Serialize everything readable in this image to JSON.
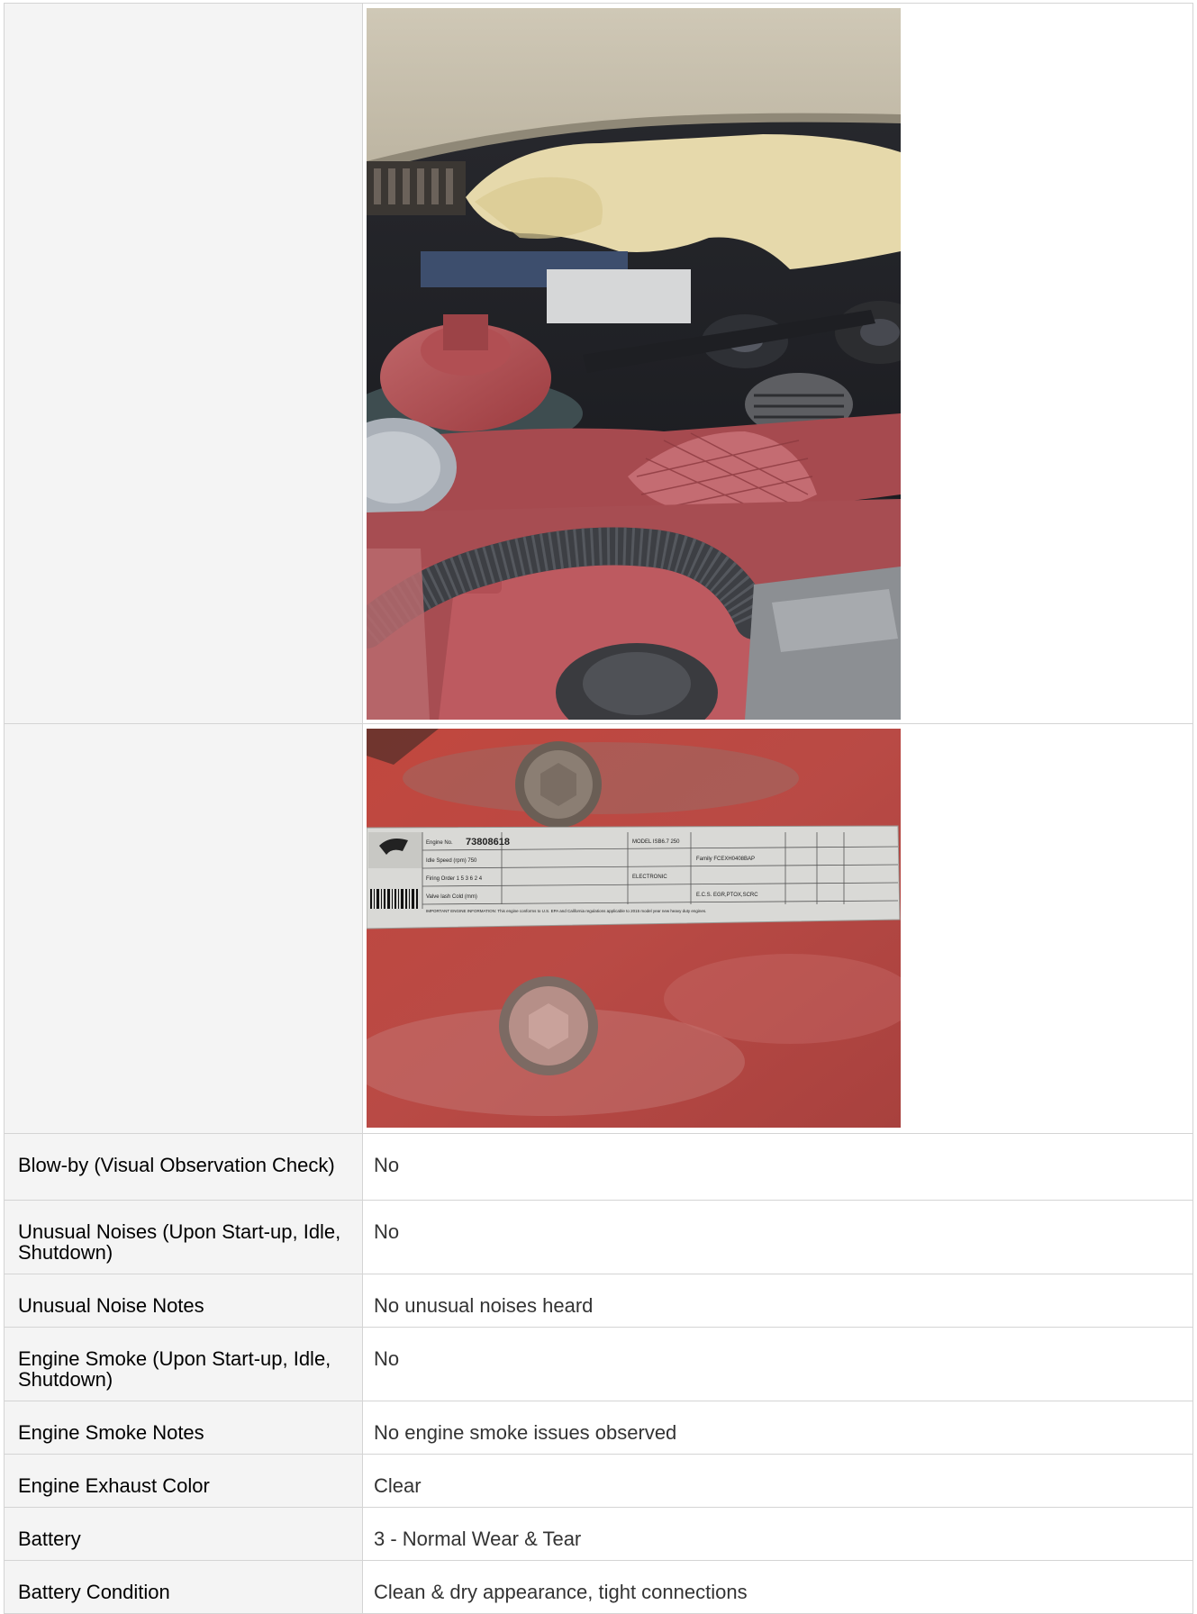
{
  "photos": [
    {
      "alt": "engine-bay-photo"
    },
    {
      "alt": "engine-data-plate-photo"
    }
  ],
  "plate_text": {
    "engine_no": "73808618",
    "model": "MODEL ISB6.7 250",
    "idle_speed": "Idle Speed (rpm) 750",
    "firing_order": "Firing Order 1 5 3 6 2 4",
    "valve_lash": "Valve lash Cold (mm)",
    "family": "Family FCEXH0408BAP",
    "electronic": "ELECTRONIC",
    "ecs": "E.C.S. EGR,PTOX,SCRC",
    "notice": "IMPORTANT ENGINE INFORMATION: This engine conforms to U.S. EPA and California regulations applicable to 2015 model year new heavy duty engines."
  },
  "rows": [
    {
      "label": "Blow-by (Visual Observation Check)",
      "value": "No"
    },
    {
      "label": "Unusual Noises (Upon Start-up, Idle, Shutdown)",
      "value": "No"
    },
    {
      "label": "Unusual Noise Notes",
      "value": "No unusual noises heard"
    },
    {
      "label": "Engine Smoke (Upon Start-up, Idle, Shutdown)",
      "value": "No"
    },
    {
      "label": "Engine Smoke Notes",
      "value": "No engine smoke issues observed"
    },
    {
      "label": "Engine Exhaust Color",
      "value": "Clear"
    },
    {
      "label": "Battery",
      "value": "3 - Normal Wear & Tear"
    },
    {
      "label": "Battery Condition",
      "value": "Clean & dry appearance, tight connections"
    }
  ],
  "colors": {
    "label_bg": "#f4f4f4",
    "border": "#d4d4d4",
    "value_text": "#333333"
  }
}
